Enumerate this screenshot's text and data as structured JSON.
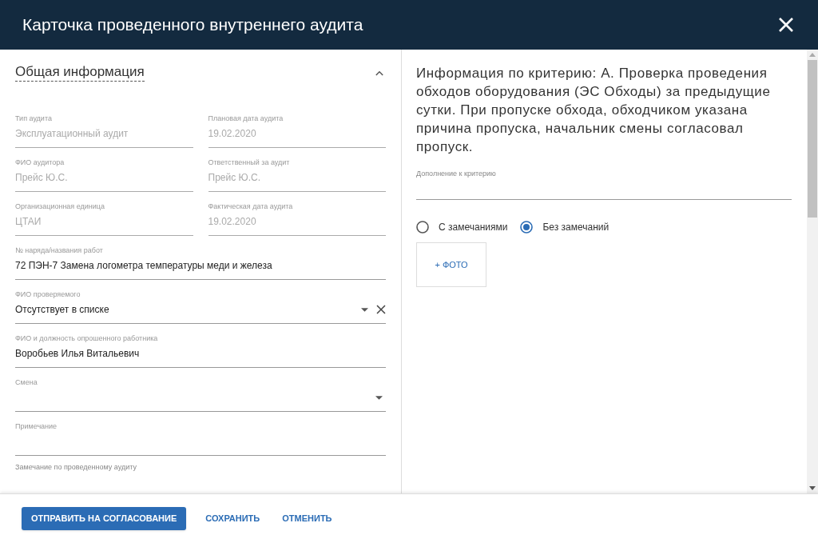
{
  "dialog": {
    "title": "Карточка проведенного внутреннего аудита"
  },
  "section": {
    "title": "Общая информация",
    "expanded": true
  },
  "field_rows": [
    [
      {
        "kind": "text",
        "label": "Тип аудита",
        "value": "Эксплуатационный аудит",
        "disabled": true
      },
      {
        "kind": "text",
        "label": "Плановая дата аудита",
        "value": "19.02.2020",
        "disabled": true
      }
    ],
    [
      {
        "kind": "text",
        "label": "ФИО аудитора",
        "value": "Прейс Ю.С.",
        "disabled": true
      },
      {
        "kind": "text",
        "label": "Ответственный за аудит",
        "value": "Прейс Ю.С.",
        "disabled": true
      }
    ],
    [
      {
        "kind": "text",
        "label": "Организационная единица",
        "value": "ЦТАИ",
        "disabled": true
      },
      {
        "kind": "text",
        "label": "Фактическая дата аудита",
        "value": "19.02.2020",
        "disabled": true
      }
    ],
    [
      {
        "kind": "text",
        "label": "№ наряда/названия работ",
        "value": "72 ПЭН-7 Замена логометра  температуры меди и железа",
        "disabled": false
      }
    ],
    [
      {
        "kind": "select",
        "label": "ФИО проверяемого",
        "value": "Отсутствует в списке",
        "disabled": false,
        "clearable": true
      }
    ],
    [
      {
        "kind": "text",
        "label": "ФИО и должность опрошенного работника",
        "value": "Воробьев Илья Витальевич",
        "disabled": false
      }
    ],
    [
      {
        "kind": "select",
        "label": "Смена",
        "disabled": false,
        "clearable": false
      }
    ],
    [
      {
        "kind": "text",
        "label": "Примечание",
        "disabled": false
      }
    ],
    [
      {
        "kind": "label_only",
        "label": "Замечание по проведенному аудиту"
      }
    ]
  ],
  "criterion": {
    "text": "Информация по критерию: А. Проверка проведения обходов оборудования (ЭС Обходы) за предыдущие сутки. При пропуске обхода, обходчиком указана причина пропуска, начальник смены согласовал пропуск.",
    "addition_label": "Дополнение к критерию",
    "options": [
      {
        "label": "С замечаниями",
        "selected": false
      },
      {
        "label": "Без замечаний",
        "selected": true
      }
    ],
    "photo_button": "+ ФОТО"
  },
  "buttons": [
    {
      "kind": "primary",
      "label": "ОТПРАВИТЬ НА СОГЛАСОВАНИЕ"
    },
    {
      "kind": "text",
      "label": "СОХРАНИТЬ"
    },
    {
      "kind": "text",
      "label": "ОТМЕНИТЬ"
    }
  ]
}
